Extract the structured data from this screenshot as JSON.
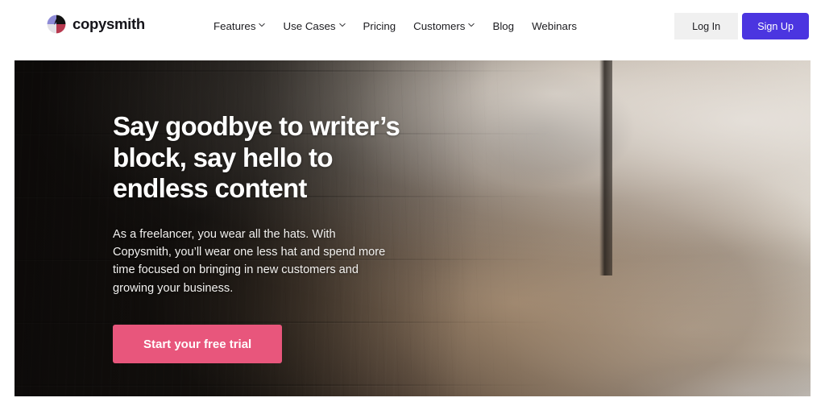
{
  "header": {
    "brand": {
      "name": "copysmith",
      "logo_icon": "copysmith-petal-logo-icon",
      "logo_colors": {
        "top_left": "#8d8ad6",
        "top_right": "#121212",
        "bottom_left": "#e3e1e6",
        "bottom_right": "#b8394f"
      }
    },
    "nav": [
      {
        "label": "Features",
        "has_dropdown": true,
        "icon": "chevron-down-icon"
      },
      {
        "label": "Use Cases",
        "has_dropdown": true,
        "icon": "chevron-down-icon"
      },
      {
        "label": "Pricing",
        "has_dropdown": false,
        "icon": ""
      },
      {
        "label": "Customers",
        "has_dropdown": true,
        "icon": "chevron-down-icon"
      },
      {
        "label": "Blog",
        "has_dropdown": false,
        "icon": ""
      },
      {
        "label": "Webinars",
        "has_dropdown": false,
        "icon": ""
      }
    ],
    "login_label": "Log In",
    "signup_label": "Sign Up"
  },
  "hero": {
    "headline": "Say goodbye to writer’s block, say hello to endless content",
    "subcopy": "As a freelancer, you wear all the hats. With Copysmith, you’ll wear one less hat and spend more time focused on bringing in new customers and growing your business.",
    "cta_label": "Start your free trial",
    "image_alt": "Man in a tan jacket sitting on a couch typing on a laptop beside a window"
  },
  "colors": {
    "brand_purple": "#4b35e0",
    "cta_pink": "#e8567c",
    "login_gray": "#f0f0f0",
    "text_dark": "#1c1c20",
    "white": "#ffffff"
  }
}
